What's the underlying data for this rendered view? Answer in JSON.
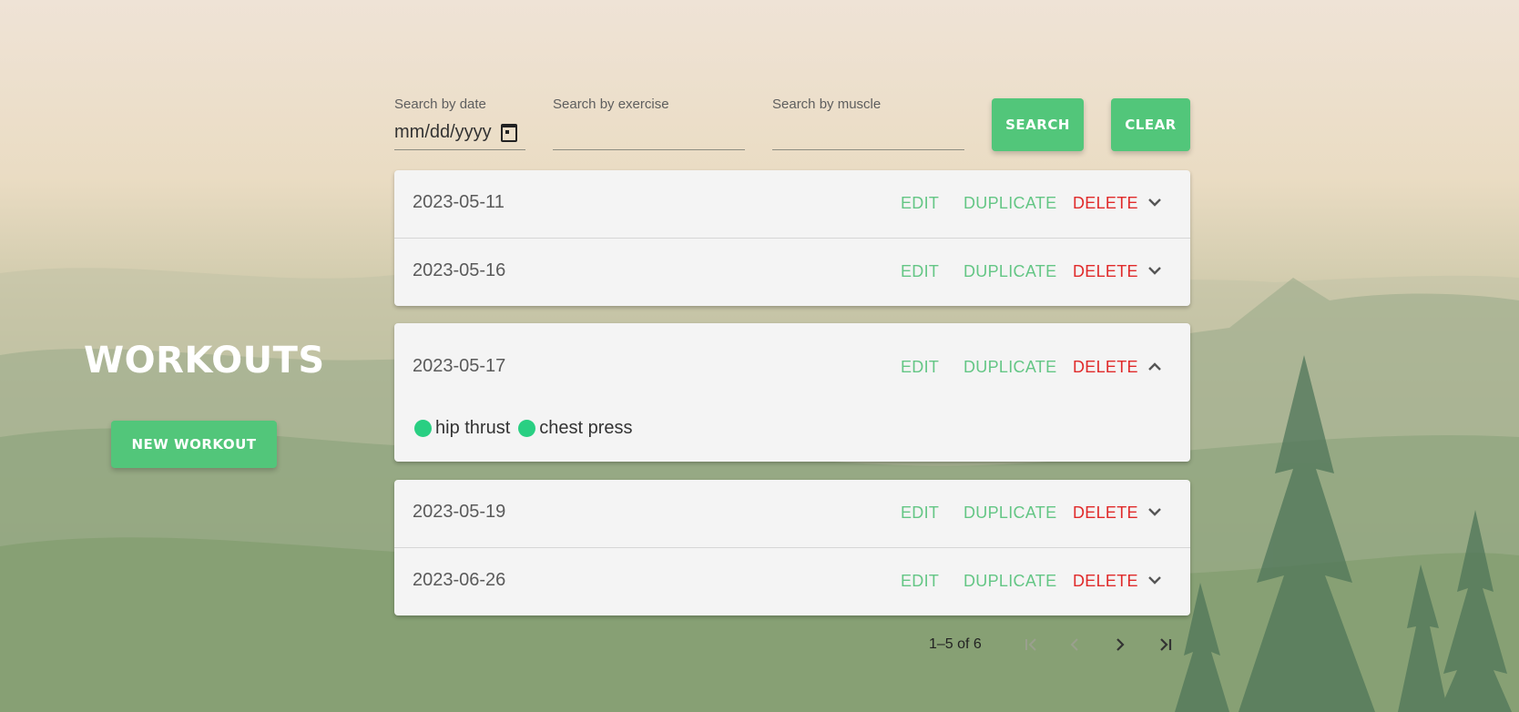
{
  "sidebar": {
    "title": "WORKOUTS",
    "new_workout_label": "NEW WORKOUT"
  },
  "search": {
    "date_label": "Search by date",
    "date_placeholder": "mm/dd/yyyy",
    "exercise_label": "Search by exercise",
    "exercise_value": "",
    "muscle_label": "Search by muscle",
    "muscle_value": "",
    "search_button": "SEARCH",
    "clear_button": "CLEAR"
  },
  "workouts": [
    {
      "date": "2023-05-11",
      "expanded": false
    },
    {
      "date": "2023-05-16",
      "expanded": false
    },
    {
      "date": "2023-05-17",
      "expanded": true,
      "exercises": [
        "hip thrust",
        "chest press"
      ]
    },
    {
      "date": "2023-05-19",
      "expanded": false
    },
    {
      "date": "2023-06-26",
      "expanded": false
    }
  ],
  "row_actions": {
    "edit": "EDIT",
    "duplicate": "DUPLICATE",
    "delete": "DELETE"
  },
  "pagination": {
    "range_text": "1–5 of 6"
  },
  "colors": {
    "accent": "#52c67a",
    "action_green": "#64c685",
    "delete_red": "#e02a2a",
    "chip_dot": "#29cf82"
  },
  "icons": {
    "expand": "chevron-down-icon",
    "collapse": "chevron-up-icon",
    "calendar": "calendar-icon",
    "first_page": "first-page-icon",
    "prev_page": "chevron-left-icon",
    "next_page": "chevron-right-icon",
    "last_page": "last-page-icon"
  }
}
